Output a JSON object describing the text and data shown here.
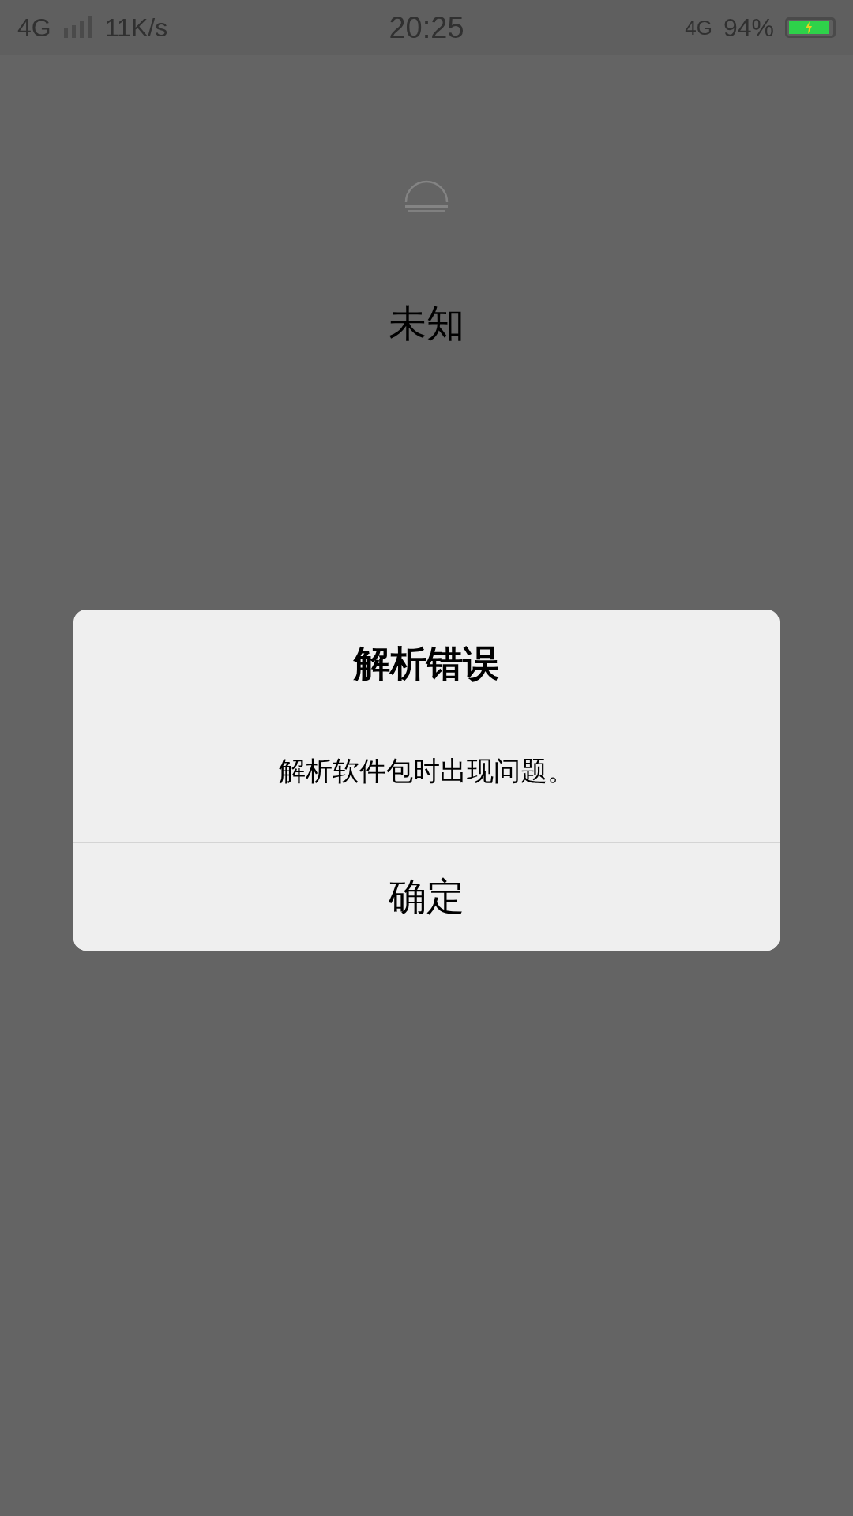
{
  "status_bar": {
    "network": "4G",
    "speed": "11K/s",
    "time": "20:25",
    "data_network": "4G",
    "battery_percent": "94%",
    "battery": {
      "level": 0.94,
      "charging": true
    }
  },
  "app": {
    "label": "未知"
  },
  "dialog": {
    "title": "解析错误",
    "message": "解析软件包时出现问题。",
    "buttons": [
      "确定"
    ]
  }
}
